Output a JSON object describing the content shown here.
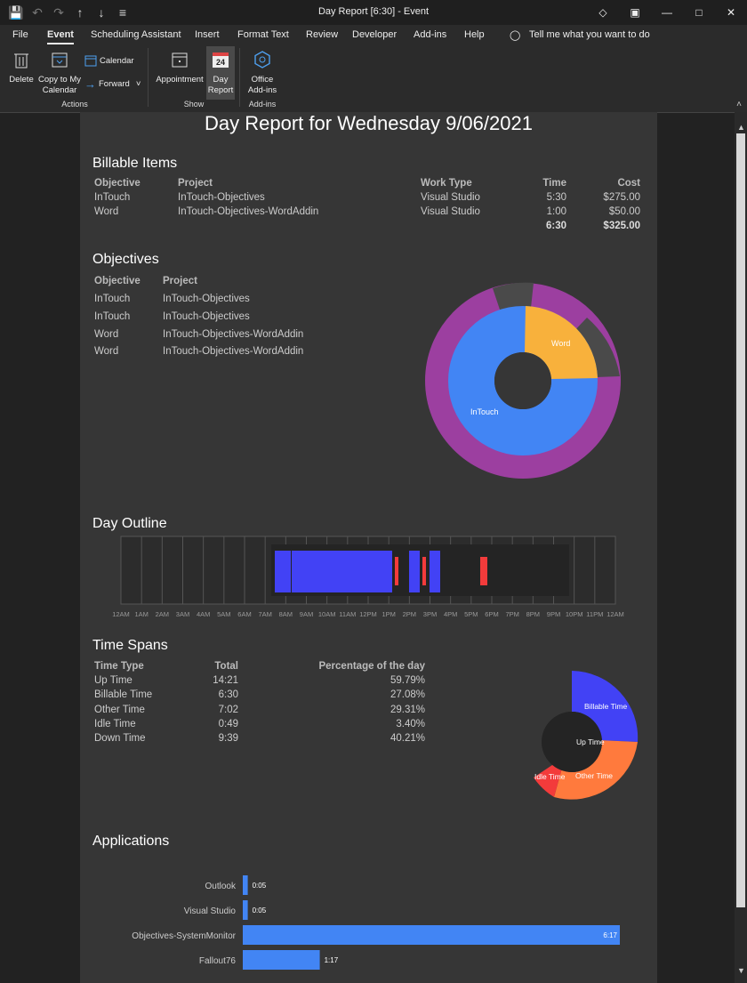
{
  "window": {
    "title": "Day Report [6:30] - Event"
  },
  "menu": {
    "file": "File",
    "event": "Event",
    "sched": "Scheduling Assistant",
    "insert": "Insert",
    "format": "Format Text",
    "review": "Review",
    "developer": "Developer",
    "addins": "Add-ins",
    "help": "Help",
    "tell": "Tell me what you want to do"
  },
  "ribbon": {
    "delete": "Delete",
    "copy1": "Copy to My",
    "copy2": "Calendar",
    "calendar": "Calendar",
    "forward": "Forward",
    "actions": "Actions",
    "appointment": "Appointment",
    "day1": "Day",
    "day2": "Report",
    "show": "Show",
    "office1": "Office",
    "office2": "Add-ins",
    "addins_group": "Add-ins",
    "day_num": "24"
  },
  "report": {
    "title": "Day Report for Wednesday 9/06/2021",
    "billable": {
      "heading": "Billable Items",
      "cols": {
        "objective": "Objective",
        "project": "Project",
        "worktype": "Work Type",
        "time": "Time",
        "cost": "Cost"
      },
      "rows": [
        {
          "objective": "InTouch",
          "project": "InTouch-Objectives",
          "worktype": "Visual Studio",
          "time": "5:30",
          "cost": "$275.00"
        },
        {
          "objective": "Word",
          "project": "InTouch-Objectives-WordAddin",
          "worktype": "Visual Studio",
          "time": "1:00",
          "cost": "$50.00"
        }
      ],
      "total_time": "6:30",
      "total_cost": "$325.00"
    },
    "objectives": {
      "heading": "Objectives",
      "cols": {
        "objective": "Objective",
        "project": "Project"
      },
      "rows": [
        {
          "objective": "InTouch",
          "project": "InTouch-Objectives"
        },
        {
          "objective": "InTouch",
          "project": "InTouch-Objectives"
        },
        {
          "objective": "Word",
          "project": "InTouch-Objectives-WordAddin"
        },
        {
          "objective": "Word",
          "project": "InTouch-Objectives-WordAddin"
        }
      ],
      "donut_labels": {
        "intouch": "InTouch",
        "word": "Word"
      }
    },
    "outline": {
      "heading": "Day Outline",
      "hours": [
        "12AM",
        "1AM",
        "2AM",
        "3AM",
        "4AM",
        "5AM",
        "6AM",
        "7AM",
        "8AM",
        "9AM",
        "10AM",
        "11AM",
        "12PM",
        "1PM",
        "2PM",
        "3PM",
        "4PM",
        "5PM",
        "6PM",
        "7PM",
        "8PM",
        "9PM",
        "10PM",
        "11PM",
        "12AM"
      ]
    },
    "spans": {
      "heading": "Time Spans",
      "cols": {
        "type": "Time Type",
        "total": "Total",
        "pct": "Percentage of the day"
      },
      "rows": [
        {
          "type": "Up Time",
          "total": "14:21",
          "pct": "59.79%"
        },
        {
          "type": "Billable Time",
          "total": "6:30",
          "pct": "27.08%"
        },
        {
          "type": "Other Time",
          "total": "7:02",
          "pct": "29.31%"
        },
        {
          "type": "Idle Time",
          "total": "0:49",
          "pct": "3.40%"
        },
        {
          "type": "Down Time",
          "total": "9:39",
          "pct": "40.21%"
        }
      ],
      "chart_labels": {
        "billable": "Billable Time",
        "up": "Up Time",
        "other": "Other Time",
        "idle": "Idle Time"
      }
    },
    "apps": {
      "heading": "Applications"
    }
  },
  "chart_data": {
    "type": "bar",
    "categories": [
      "Outlook",
      "Visual Studio",
      "Objectives-SystemMonitor",
      "Fallout76"
    ],
    "values": [
      0.083,
      0.083,
      6.283,
      1.283
    ],
    "value_labels": [
      "0:05",
      "0:05",
      "6:17",
      "1:17"
    ]
  },
  "colors": {
    "blue": "#4285f4",
    "purple": "#9c3fa0",
    "orange": "#f8b13c",
    "gray": "#4a4a4a",
    "bar_blue": "#4242f5",
    "red": "#f33b3b",
    "other_orange": "#ff7a3d"
  }
}
